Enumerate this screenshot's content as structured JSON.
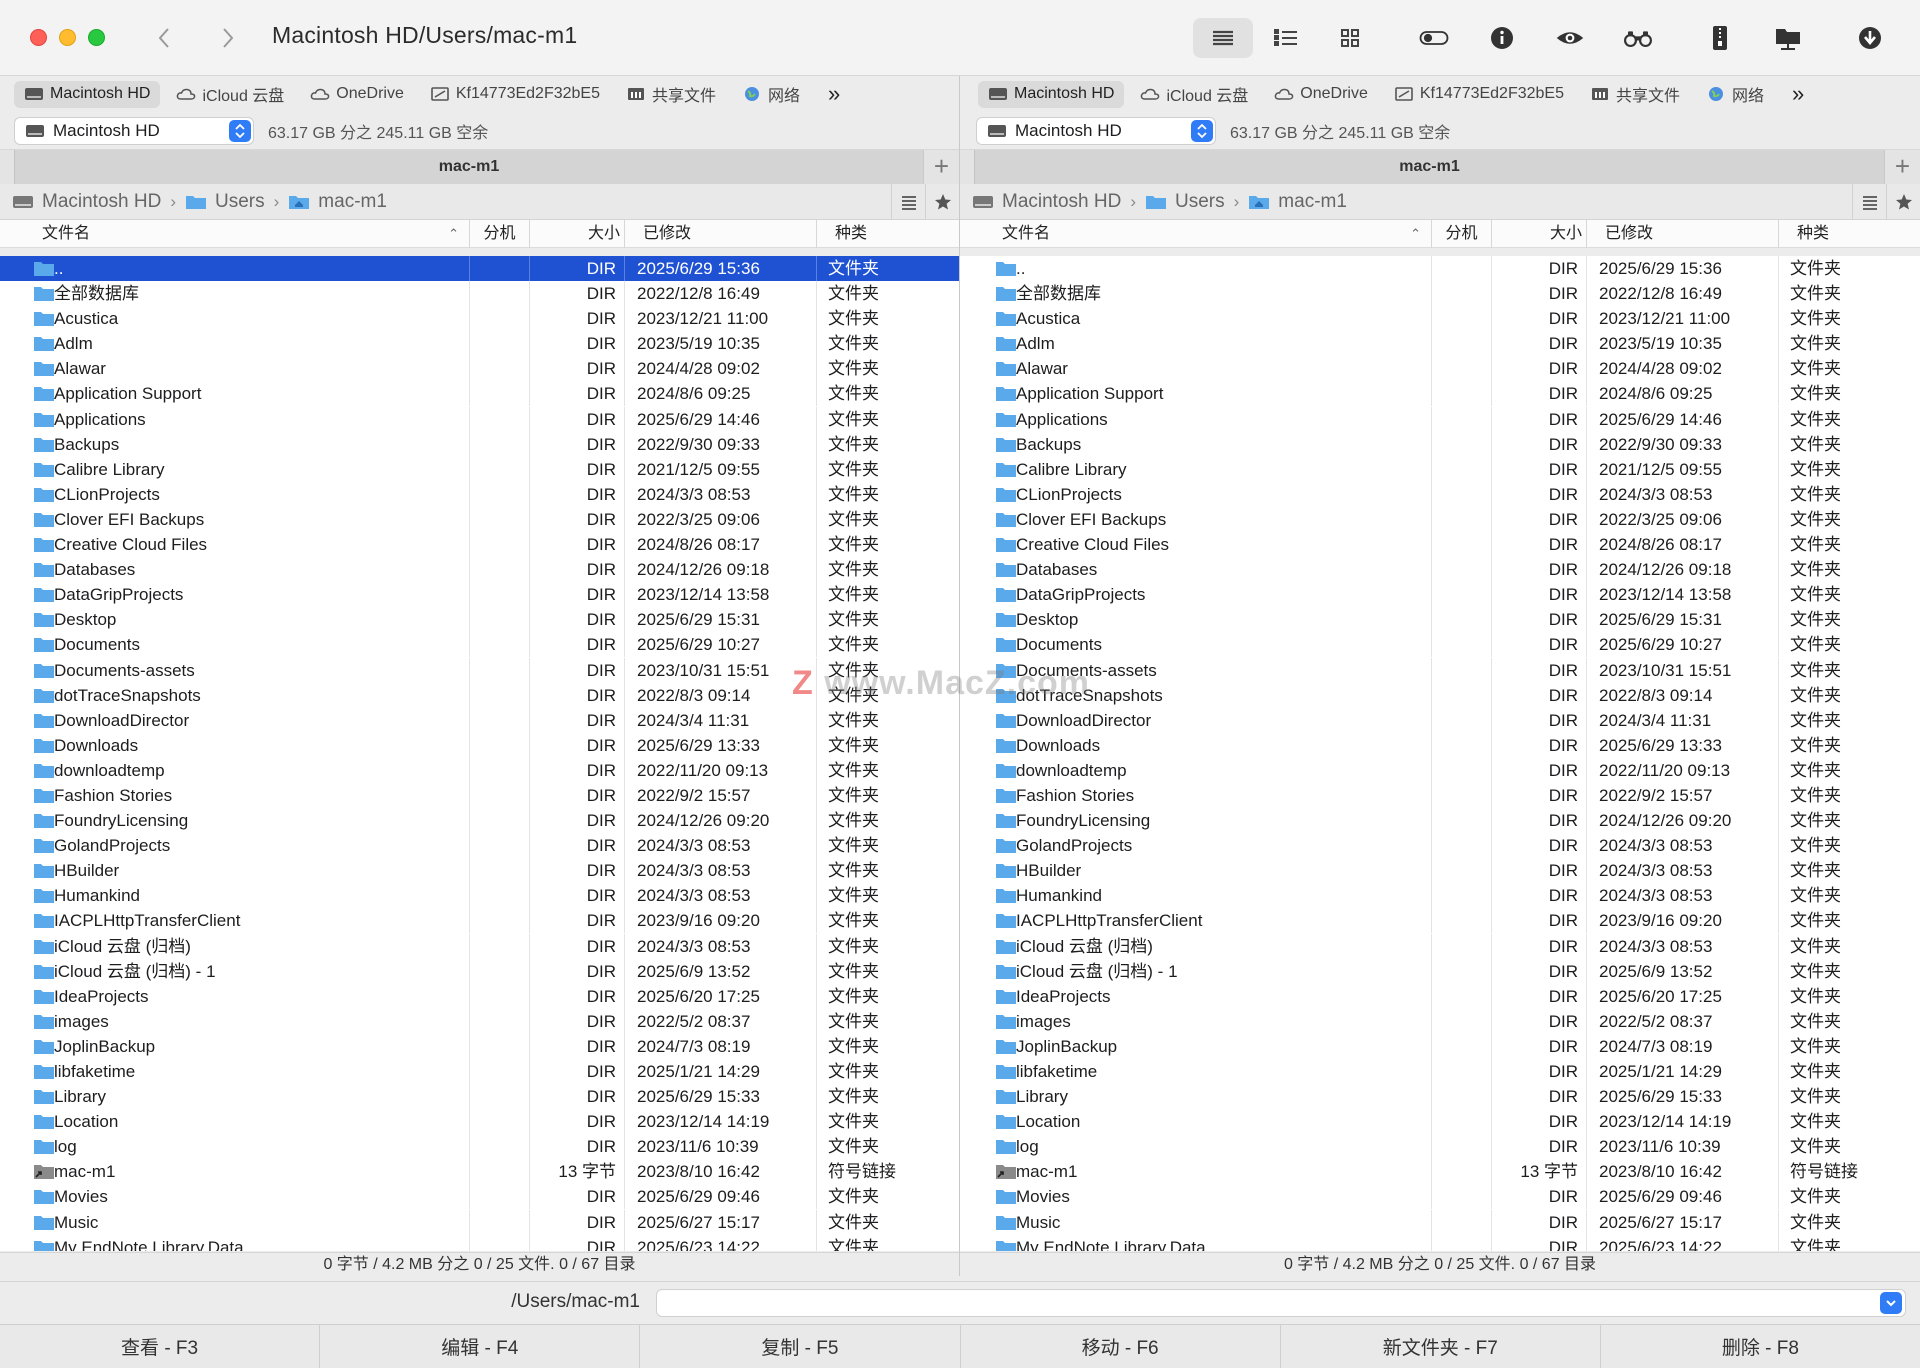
{
  "window": {
    "title": "Macintosh HD/Users/mac-m1"
  },
  "favorites": [
    {
      "label": "Macintosh HD",
      "icon": "hard-drive-icon"
    },
    {
      "label": "iCloud 云盘",
      "icon": "cloud-icon"
    },
    {
      "label": "OneDrive",
      "icon": "cloud-icon"
    },
    {
      "label": "Kf14773Ed2F32bE5",
      "icon": "network-drive-icon"
    },
    {
      "label": "共享文件",
      "icon": "shared-folder-icon"
    },
    {
      "label": "网络",
      "icon": "globe-icon"
    }
  ],
  "more_label": "»",
  "drive": {
    "name": "Macintosh HD",
    "space": "63.17 GB 分之 245.11 GB 空余"
  },
  "tab_label": "mac-m1",
  "breadcrumb": [
    "Macintosh HD",
    "Users",
    "mac-m1"
  ],
  "columns": {
    "name": "文件名",
    "ext": "分机",
    "size": "大小",
    "modified": "已修改",
    "kind": "种类"
  },
  "files": [
    {
      "name": "..",
      "size": "DIR",
      "modified": "2025/6/29 15:36",
      "kind": "文件夹"
    },
    {
      "name": "全部数据库",
      "size": "DIR",
      "modified": "2022/12/8 16:49",
      "kind": "文件夹"
    },
    {
      "name": "Acustica",
      "size": "DIR",
      "modified": "2023/12/21 11:00",
      "kind": "文件夹"
    },
    {
      "name": "Adlm",
      "size": "DIR",
      "modified": "2023/5/19 10:35",
      "kind": "文件夹"
    },
    {
      "name": "Alawar",
      "size": "DIR",
      "modified": "2024/4/28 09:02",
      "kind": "文件夹"
    },
    {
      "name": "Application Support",
      "size": "DIR",
      "modified": "2024/8/6 09:25",
      "kind": "文件夹"
    },
    {
      "name": "Applications",
      "size": "DIR",
      "modified": "2025/6/29 14:46",
      "kind": "文件夹"
    },
    {
      "name": "Backups",
      "size": "DIR",
      "modified": "2022/9/30 09:33",
      "kind": "文件夹"
    },
    {
      "name": "Calibre Library",
      "size": "DIR",
      "modified": "2021/12/5 09:55",
      "kind": "文件夹"
    },
    {
      "name": "CLionProjects",
      "size": "DIR",
      "modified": "2024/3/3 08:53",
      "kind": "文件夹"
    },
    {
      "name": "Clover EFI Backups",
      "size": "DIR",
      "modified": "2022/3/25 09:06",
      "kind": "文件夹"
    },
    {
      "name": "Creative Cloud Files",
      "size": "DIR",
      "modified": "2024/8/26 08:17",
      "kind": "文件夹"
    },
    {
      "name": "Databases",
      "size": "DIR",
      "modified": "2024/12/26 09:18",
      "kind": "文件夹"
    },
    {
      "name": "DataGripProjects",
      "size": "DIR",
      "modified": "2023/12/14 13:58",
      "kind": "文件夹"
    },
    {
      "name": "Desktop",
      "size": "DIR",
      "modified": "2025/6/29 15:31",
      "kind": "文件夹"
    },
    {
      "name": "Documents",
      "size": "DIR",
      "modified": "2025/6/29 10:27",
      "kind": "文件夹"
    },
    {
      "name": "Documents-assets",
      "size": "DIR",
      "modified": "2023/10/31 15:51",
      "kind": "文件夹"
    },
    {
      "name": "dotTraceSnapshots",
      "size": "DIR",
      "modified": "2022/8/3 09:14",
      "kind": "文件夹"
    },
    {
      "name": "DownloadDirector",
      "size": "DIR",
      "modified": "2024/3/4 11:31",
      "kind": "文件夹"
    },
    {
      "name": "Downloads",
      "size": "DIR",
      "modified": "2025/6/29 13:33",
      "kind": "文件夹"
    },
    {
      "name": "downloadtemp",
      "size": "DIR",
      "modified": "2022/11/20 09:13",
      "kind": "文件夹"
    },
    {
      "name": "Fashion Stories",
      "size": "DIR",
      "modified": "2022/9/2 15:57",
      "kind": "文件夹"
    },
    {
      "name": "FoundryLicensing",
      "size": "DIR",
      "modified": "2024/12/26 09:20",
      "kind": "文件夹"
    },
    {
      "name": "GolandProjects",
      "size": "DIR",
      "modified": "2024/3/3 08:53",
      "kind": "文件夹"
    },
    {
      "name": "HBuilder",
      "size": "DIR",
      "modified": "2024/3/3 08:53",
      "kind": "文件夹"
    },
    {
      "name": "Humankind",
      "size": "DIR",
      "modified": "2024/3/3 08:53",
      "kind": "文件夹"
    },
    {
      "name": "IACPLHttpTransferClient",
      "size": "DIR",
      "modified": "2023/9/16 09:20",
      "kind": "文件夹"
    },
    {
      "name": "iCloud 云盘 (归档)",
      "size": "DIR",
      "modified": "2024/3/3 08:53",
      "kind": "文件夹"
    },
    {
      "name": "iCloud 云盘 (归档) - 1",
      "size": "DIR",
      "modified": "2025/6/9 13:52",
      "kind": "文件夹"
    },
    {
      "name": "IdeaProjects",
      "size": "DIR",
      "modified": "2025/6/20 17:25",
      "kind": "文件夹"
    },
    {
      "name": "images",
      "size": "DIR",
      "modified": "2022/5/2 08:37",
      "kind": "文件夹"
    },
    {
      "name": "JoplinBackup",
      "size": "DIR",
      "modified": "2024/7/3 08:19",
      "kind": "文件夹"
    },
    {
      "name": "libfaketime",
      "size": "DIR",
      "modified": "2025/1/21 14:29",
      "kind": "文件夹"
    },
    {
      "name": "Library",
      "size": "DIR",
      "modified": "2025/6/29 15:33",
      "kind": "文件夹"
    },
    {
      "name": "Location",
      "size": "DIR",
      "modified": "2023/12/14 14:19",
      "kind": "文件夹"
    },
    {
      "name": "log",
      "size": "DIR",
      "modified": "2023/11/6 10:39",
      "kind": "文件夹"
    },
    {
      "name": "mac-m1",
      "size": "13 字节",
      "modified": "2023/8/10 16:42",
      "kind": "符号链接"
    },
    {
      "name": "Movies",
      "size": "DIR",
      "modified": "2025/6/29 09:46",
      "kind": "文件夹"
    },
    {
      "name": "Music",
      "size": "DIR",
      "modified": "2025/6/27 15:17",
      "kind": "文件夹"
    },
    {
      "name": "My EndNote Library.Data",
      "size": "DIR",
      "modified": "2025/6/23 14:22",
      "kind": "文件夹"
    }
  ],
  "status": "0 字节 / 4.2 MB 分之 0 / 25 文件. 0 / 67 目录",
  "command": {
    "path": "/Users/mac-m1"
  },
  "fkeys": [
    "查看 - F3",
    "编辑 - F4",
    "复制 - F5",
    "移动 - F6",
    "新文件夹 - F7",
    "删除 - F8"
  ],
  "watermark": {
    "z": "Z",
    "text": "www.MacZ.com"
  },
  "colors": {
    "accent": "#2f7cf6",
    "selection": "#1f52d3",
    "folder": "#5aa9ea"
  }
}
